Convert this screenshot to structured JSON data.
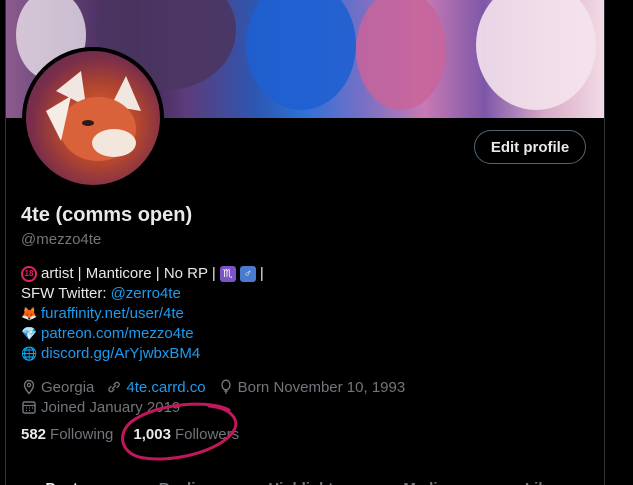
{
  "profile": {
    "edit_label": "Edit profile",
    "name": "4te (comms open)",
    "handle": "@mezzo4te",
    "bio": {
      "line1_text": "artist | Manticore | No RP |",
      "line1_badge": "18",
      "line1_symbol1": "♏",
      "line1_symbol2": "♂",
      "line1_tail": "|",
      "line2_prefix": "SFW Twitter:",
      "line2_link": "@zerro4te",
      "line3_link": "furaffinity.net/user/4te",
      "line4_link": "patreon.com/mezzo4te",
      "line5_link": "discord.gg/ArYjwbxBM4"
    },
    "location": "Georgia",
    "website": "4te.carrd.co",
    "born": "Born November 10, 1993",
    "joined": "Joined January 2019",
    "following_count": "582",
    "following_label": "Following",
    "followers_count": "1,003",
    "followers_label": "Followers"
  },
  "tabs": [
    "Posts",
    "Replies",
    "Highlights",
    "Media",
    "Likes"
  ],
  "colors": {
    "background": "#000000",
    "text": "#e7e9ea",
    "muted": "#71767b",
    "link": "#1d9bf0",
    "annotation": "#c2185b"
  }
}
